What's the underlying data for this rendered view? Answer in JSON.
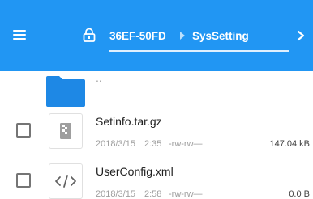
{
  "header": {
    "background": "#2196f3",
    "menu_icon": "hamburger-menu-icon",
    "lock_icon": "lock-icon",
    "breadcrumb_root": "36EF-50FD",
    "breadcrumb_current": "SysSetting",
    "next_icon": "chevron-right-icon"
  },
  "parent_folder": {
    "label": "..",
    "icon": "folder-icon",
    "color": "#1e88e5"
  },
  "files": [
    {
      "name": "Setinfo.tar.gz",
      "date": "2018/3/15",
      "time": "2:35",
      "permissions": "-rw-rw—",
      "size": "147.04 kB",
      "icon": "archive-icon"
    },
    {
      "name": "UserConfig.xml",
      "date": "2018/3/15",
      "time": "2:58",
      "permissions": "-rw-rw—",
      "size": "0.0 B",
      "icon": "code-file-icon"
    }
  ]
}
